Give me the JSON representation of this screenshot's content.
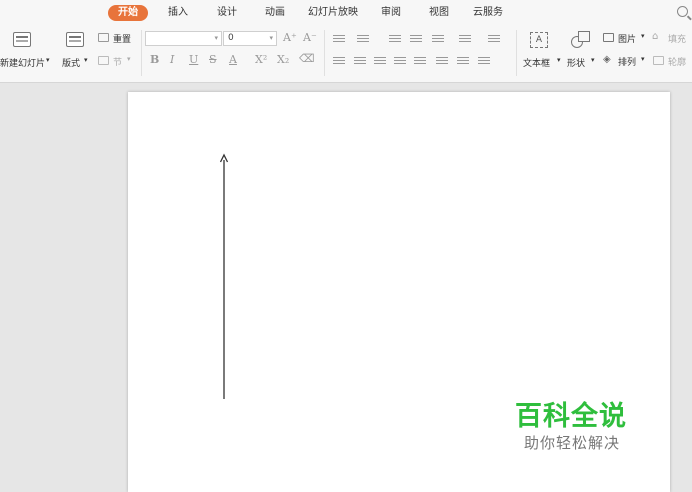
{
  "tabs": [
    {
      "label": "开始",
      "active": true
    },
    {
      "label": "插入",
      "active": false
    },
    {
      "label": "设计",
      "active": false
    },
    {
      "label": "动画",
      "active": false
    },
    {
      "label": "幻灯片放映",
      "active": false
    },
    {
      "label": "审阅",
      "active": false
    },
    {
      "label": "视图",
      "active": false
    },
    {
      "label": "云服务",
      "active": false
    }
  ],
  "ribbon": {
    "new_slide": "新建幻灯片",
    "layout": "版式",
    "reset": "重置",
    "section": "节",
    "font_name": "",
    "font_size": "0",
    "textbox": "文本框",
    "shape": "形状",
    "picture": "图片",
    "arrange": "排列",
    "fill": "填充",
    "outline": "轮廓"
  },
  "watermark": {
    "title": "百科全说",
    "subtitle": "助你轻松解决"
  },
  "colors": {
    "accent": "#e8743b",
    "watermark_green": "#2fbe3d"
  }
}
